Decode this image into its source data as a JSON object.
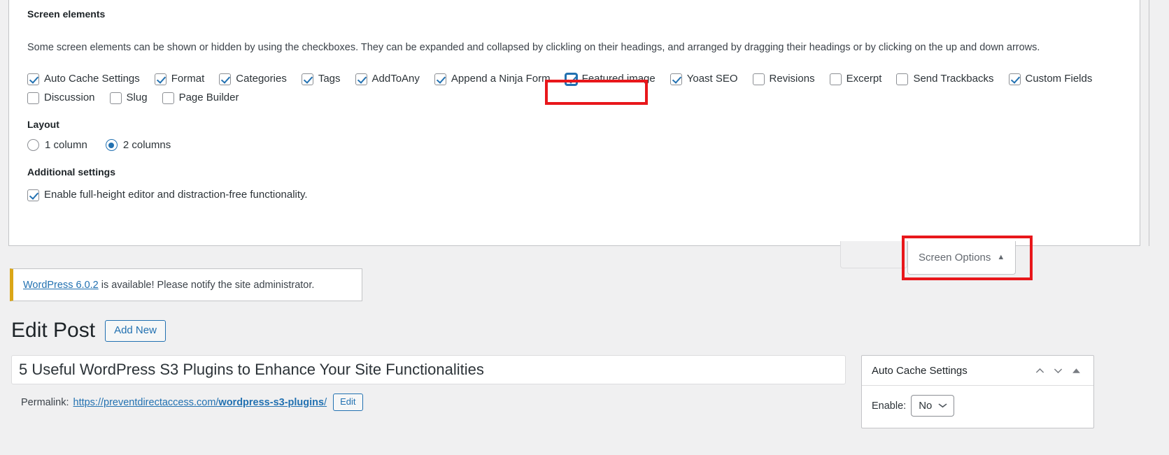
{
  "screen_options": {
    "legend": "Screen elements",
    "description": "Some screen elements can be shown or hidden by using the checkboxes. They can be expanded and collapsed by clickling on their headings, and arranged by dragging their headings or by clicking on the up and down arrows.",
    "elements_row1": [
      {
        "label": "Auto Cache Settings",
        "checked": true
      },
      {
        "label": "Format",
        "checked": true
      },
      {
        "label": "Categories",
        "checked": true
      },
      {
        "label": "Tags",
        "checked": true
      },
      {
        "label": "AddToAny",
        "checked": true
      },
      {
        "label": "Append a Ninja Form",
        "checked": true
      },
      {
        "label": "Featured image",
        "checked": true
      },
      {
        "label": "Yoast SEO",
        "checked": true
      },
      {
        "label": "Revisions",
        "checked": false
      },
      {
        "label": "Excerpt",
        "checked": false
      },
      {
        "label": "Send Trackbacks",
        "checked": false
      },
      {
        "label": "Custom Fields",
        "checked": true
      }
    ],
    "elements_row2": [
      {
        "label": "Discussion",
        "checked": false
      },
      {
        "label": "Slug",
        "checked": false
      },
      {
        "label": "Page Builder",
        "checked": false
      }
    ],
    "layout": {
      "legend": "Layout",
      "options": [
        {
          "label": "1 column",
          "selected": false
        },
        {
          "label": "2 columns",
          "selected": true
        }
      ]
    },
    "additional": {
      "legend": "Additional settings",
      "fullheight": {
        "label": "Enable full-height editor and distraction-free functionality.",
        "checked": true
      }
    },
    "tab_label": "Screen Options",
    "tab_caret": "▲"
  },
  "notice": {
    "link_text": "WordPress 6.0.2",
    "rest_text": " is available! Please notify the site administrator."
  },
  "header": {
    "page_title": "Edit Post",
    "add_new_label": "Add New"
  },
  "post": {
    "title_value": "5 Useful WordPress S3 Plugins to Enhance Your Site Functionalities",
    "permalink_label": "Permalink:",
    "permalink_base": "https://preventdirectaccess.com/",
    "permalink_slug": "wordpress-s3-plugins",
    "permalink_trailing": "/",
    "edit_slug_label": "Edit"
  },
  "metabox": {
    "title": "Auto Cache Settings",
    "field_label": "Enable:",
    "field_value": "No",
    "caret": "⌄"
  },
  "colors": {
    "accent_blue": "#2271b1",
    "highlight_red": "#e8171b",
    "notice_yellow": "#dba617"
  }
}
